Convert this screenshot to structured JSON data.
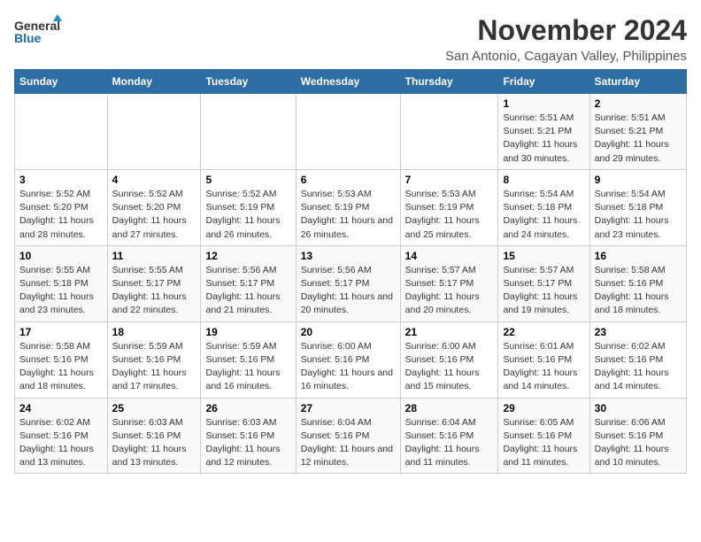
{
  "header": {
    "logo_general": "General",
    "logo_blue": "Blue",
    "title": "November 2024",
    "subtitle": "San Antonio, Cagayan Valley, Philippines"
  },
  "columns": [
    "Sunday",
    "Monday",
    "Tuesday",
    "Wednesday",
    "Thursday",
    "Friday",
    "Saturday"
  ],
  "weeks": [
    [
      {
        "day": "",
        "sunrise": "",
        "sunset": "",
        "daylight": ""
      },
      {
        "day": "",
        "sunrise": "",
        "sunset": "",
        "daylight": ""
      },
      {
        "day": "",
        "sunrise": "",
        "sunset": "",
        "daylight": ""
      },
      {
        "day": "",
        "sunrise": "",
        "sunset": "",
        "daylight": ""
      },
      {
        "day": "",
        "sunrise": "",
        "sunset": "",
        "daylight": ""
      },
      {
        "day": "1",
        "sunrise": "Sunrise: 5:51 AM",
        "sunset": "Sunset: 5:21 PM",
        "daylight": "Daylight: 11 hours and 30 minutes."
      },
      {
        "day": "2",
        "sunrise": "Sunrise: 5:51 AM",
        "sunset": "Sunset: 5:21 PM",
        "daylight": "Daylight: 11 hours and 29 minutes."
      }
    ],
    [
      {
        "day": "3",
        "sunrise": "Sunrise: 5:52 AM",
        "sunset": "Sunset: 5:20 PM",
        "daylight": "Daylight: 11 hours and 28 minutes."
      },
      {
        "day": "4",
        "sunrise": "Sunrise: 5:52 AM",
        "sunset": "Sunset: 5:20 PM",
        "daylight": "Daylight: 11 hours and 27 minutes."
      },
      {
        "day": "5",
        "sunrise": "Sunrise: 5:52 AM",
        "sunset": "Sunset: 5:19 PM",
        "daylight": "Daylight: 11 hours and 26 minutes."
      },
      {
        "day": "6",
        "sunrise": "Sunrise: 5:53 AM",
        "sunset": "Sunset: 5:19 PM",
        "daylight": "Daylight: 11 hours and 26 minutes."
      },
      {
        "day": "7",
        "sunrise": "Sunrise: 5:53 AM",
        "sunset": "Sunset: 5:19 PM",
        "daylight": "Daylight: 11 hours and 25 minutes."
      },
      {
        "day": "8",
        "sunrise": "Sunrise: 5:54 AM",
        "sunset": "Sunset: 5:18 PM",
        "daylight": "Daylight: 11 hours and 24 minutes."
      },
      {
        "day": "9",
        "sunrise": "Sunrise: 5:54 AM",
        "sunset": "Sunset: 5:18 PM",
        "daylight": "Daylight: 11 hours and 23 minutes."
      }
    ],
    [
      {
        "day": "10",
        "sunrise": "Sunrise: 5:55 AM",
        "sunset": "Sunset: 5:18 PM",
        "daylight": "Daylight: 11 hours and 23 minutes."
      },
      {
        "day": "11",
        "sunrise": "Sunrise: 5:55 AM",
        "sunset": "Sunset: 5:17 PM",
        "daylight": "Daylight: 11 hours and 22 minutes."
      },
      {
        "day": "12",
        "sunrise": "Sunrise: 5:56 AM",
        "sunset": "Sunset: 5:17 PM",
        "daylight": "Daylight: 11 hours and 21 minutes."
      },
      {
        "day": "13",
        "sunrise": "Sunrise: 5:56 AM",
        "sunset": "Sunset: 5:17 PM",
        "daylight": "Daylight: 11 hours and 20 minutes."
      },
      {
        "day": "14",
        "sunrise": "Sunrise: 5:57 AM",
        "sunset": "Sunset: 5:17 PM",
        "daylight": "Daylight: 11 hours and 20 minutes."
      },
      {
        "day": "15",
        "sunrise": "Sunrise: 5:57 AM",
        "sunset": "Sunset: 5:17 PM",
        "daylight": "Daylight: 11 hours and 19 minutes."
      },
      {
        "day": "16",
        "sunrise": "Sunrise: 5:58 AM",
        "sunset": "Sunset: 5:16 PM",
        "daylight": "Daylight: 11 hours and 18 minutes."
      }
    ],
    [
      {
        "day": "17",
        "sunrise": "Sunrise: 5:58 AM",
        "sunset": "Sunset: 5:16 PM",
        "daylight": "Daylight: 11 hours and 18 minutes."
      },
      {
        "day": "18",
        "sunrise": "Sunrise: 5:59 AM",
        "sunset": "Sunset: 5:16 PM",
        "daylight": "Daylight: 11 hours and 17 minutes."
      },
      {
        "day": "19",
        "sunrise": "Sunrise: 5:59 AM",
        "sunset": "Sunset: 5:16 PM",
        "daylight": "Daylight: 11 hours and 16 minutes."
      },
      {
        "day": "20",
        "sunrise": "Sunrise: 6:00 AM",
        "sunset": "Sunset: 5:16 PM",
        "daylight": "Daylight: 11 hours and 16 minutes."
      },
      {
        "day": "21",
        "sunrise": "Sunrise: 6:00 AM",
        "sunset": "Sunset: 5:16 PM",
        "daylight": "Daylight: 11 hours and 15 minutes."
      },
      {
        "day": "22",
        "sunrise": "Sunrise: 6:01 AM",
        "sunset": "Sunset: 5:16 PM",
        "daylight": "Daylight: 11 hours and 14 minutes."
      },
      {
        "day": "23",
        "sunrise": "Sunrise: 6:02 AM",
        "sunset": "Sunset: 5:16 PM",
        "daylight": "Daylight: 11 hours and 14 minutes."
      }
    ],
    [
      {
        "day": "24",
        "sunrise": "Sunrise: 6:02 AM",
        "sunset": "Sunset: 5:16 PM",
        "daylight": "Daylight: 11 hours and 13 minutes."
      },
      {
        "day": "25",
        "sunrise": "Sunrise: 6:03 AM",
        "sunset": "Sunset: 5:16 PM",
        "daylight": "Daylight: 11 hours and 13 minutes."
      },
      {
        "day": "26",
        "sunrise": "Sunrise: 6:03 AM",
        "sunset": "Sunset: 5:16 PM",
        "daylight": "Daylight: 11 hours and 12 minutes."
      },
      {
        "day": "27",
        "sunrise": "Sunrise: 6:04 AM",
        "sunset": "Sunset: 5:16 PM",
        "daylight": "Daylight: 11 hours and 12 minutes."
      },
      {
        "day": "28",
        "sunrise": "Sunrise: 6:04 AM",
        "sunset": "Sunset: 5:16 PM",
        "daylight": "Daylight: 11 hours and 11 minutes."
      },
      {
        "day": "29",
        "sunrise": "Sunrise: 6:05 AM",
        "sunset": "Sunset: 5:16 PM",
        "daylight": "Daylight: 11 hours and 11 minutes."
      },
      {
        "day": "30",
        "sunrise": "Sunrise: 6:06 AM",
        "sunset": "Sunset: 5:16 PM",
        "daylight": "Daylight: 11 hours and 10 minutes."
      }
    ]
  ]
}
